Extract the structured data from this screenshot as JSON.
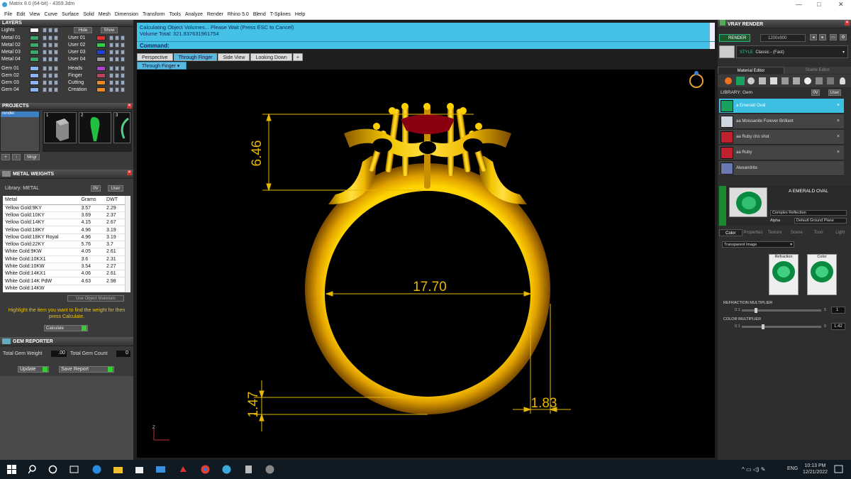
{
  "window": {
    "title": "Matrix 8.0 (64-bit) - 4359.3dm",
    "min": "—",
    "max": "□",
    "close": "✕"
  },
  "menu": [
    "File",
    "Edit",
    "View",
    "Curve",
    "Surface",
    "Solid",
    "Mesh",
    "Dimension",
    "Transform",
    "Tools",
    "Analyze",
    "Render",
    "Rhino 5.0",
    "Blend",
    "T-Splines",
    "Help"
  ],
  "layers": {
    "title": "LAYERS",
    "hide_label": "Hide",
    "show_label": "Show",
    "left": [
      {
        "name": "Lights",
        "color": "#ffffff"
      },
      {
        "name": "Metal 01",
        "color": "#3aa86a"
      },
      {
        "name": "Metal 02",
        "color": "#3aa86a"
      },
      {
        "name": "Metal 03",
        "color": "#3aa86a"
      },
      {
        "name": "Metal 04",
        "color": "#3aa86a"
      },
      {
        "name": "Gem 01",
        "color": "#8ab4f8"
      },
      {
        "name": "Gem 02",
        "color": "#8ab4f8"
      },
      {
        "name": "Gem 03",
        "color": "#8ab4f8"
      },
      {
        "name": "Gem 04",
        "color": "#8ab4f8"
      }
    ],
    "right": [
      {
        "name": "User 01",
        "color": "#e83030"
      },
      {
        "name": "User 02",
        "color": "#2ad24a"
      },
      {
        "name": "User 03",
        "color": "#2040e0"
      },
      {
        "name": "User 04",
        "color": "#9a9a9a"
      },
      {
        "name": "Heads",
        "color": "#b040d0"
      },
      {
        "name": "Finger",
        "color": "#c04060"
      },
      {
        "name": "Cutting",
        "color": "#f08a20"
      },
      {
        "name": "Creation",
        "color": "#f08a20"
      }
    ]
  },
  "projects": {
    "title": "PROJECTS",
    "item": "render",
    "thumbs": [
      "1",
      "2",
      "3"
    ],
    "mngr_label": "Mngr"
  },
  "metal_weights": {
    "title": "METAL WEIGHTS",
    "library_label": "Library: METAL",
    "lib_btn_0": "0V",
    "lib_btn_user": "User",
    "columns": [
      "Metal",
      "Grams",
      "DWT"
    ],
    "rows": [
      [
        "Yellow Gold:9KY",
        "3.57",
        "2.29"
      ],
      [
        "Yellow Gold:10KY",
        "3.69",
        "2.37"
      ],
      [
        "Yellow Gold:14KY",
        "4.15",
        "2.67"
      ],
      [
        "Yellow Gold:18KY",
        "4.96",
        "3.19"
      ],
      [
        "Yellow Gold:18KY Royal",
        "4.96",
        "3.19"
      ],
      [
        "Yellow Gold:22KY",
        "5.76",
        "3.7"
      ],
      [
        "White Gold:9KW",
        "4.05",
        "2.61"
      ],
      [
        "White Gold:10KX1",
        "3.6",
        "2.31"
      ],
      [
        "White Gold:10KW",
        "3.54",
        "2.27"
      ],
      [
        "White Gold:14KX1",
        "4.06",
        "2.61"
      ],
      [
        "White Gold:14K PdW",
        "4.63",
        "2.98"
      ],
      [
        "White Gold:14KW",
        "",
        ""
      ]
    ],
    "use_object_materials": "Use Object Materials",
    "hint": "Highlight the item you want to find the weight for then press Calculate.",
    "calculate": "Calculate"
  },
  "gem_reporter": {
    "title": "GEM REPORTER",
    "total_weight_label": "Total Gem Weight",
    "total_weight_value": ".00",
    "total_count_label": "Total Gem Count",
    "total_count_value": "0",
    "update": "Update",
    "save_report": "Save Report"
  },
  "messages": {
    "line1": "Calculating Object Volumes... Please Wait (Press ESC to Cancel)",
    "line2": "Volume Total: 321.837631961754",
    "command_label": "Command:"
  },
  "view_tabs": [
    "Perspective",
    "Through Finger",
    "Side View",
    "Looking Down",
    "+"
  ],
  "active_view": "Through Finger",
  "dimensions": {
    "top": "6.46",
    "width": "17.70",
    "bottom_left": "1.47",
    "bottom_right": "1.83"
  },
  "axis_label": "Z",
  "vray": {
    "title": "VRAY RENDER",
    "render_btn": "RENDER",
    "resolution": "1200x900",
    "style_label": "STYLE",
    "style_value": "Classic - (Fast)",
    "tabs": [
      "Material Editor",
      "Scene Editor"
    ],
    "library_label": "LIBRARY: Gem",
    "lib_btn_0": "0V",
    "lib_btn_user": "User",
    "materials": [
      {
        "name": "a Emerald Oval",
        "color": "#19a060"
      },
      {
        "name": "aa Moissanite Forever Brilliant",
        "color": "#cfd6e0"
      },
      {
        "name": "aa Ruby cho shot",
        "color": "#c02030"
      },
      {
        "name": "aa Ruby",
        "color": "#c02030"
      },
      {
        "name": "Alexandrite",
        "color": "#6a7ab0"
      }
    ],
    "selected_name": "A EMERALD OVAL",
    "reflection": "Complex Reflection",
    "alpha_label": "Alpha",
    "ground": "Default Ground Plane",
    "prop_tabs": [
      "Color",
      "Properties",
      "Texture",
      "Scene",
      "Toon",
      "Light"
    ],
    "transparent": "Transparent Image",
    "refraction_label": "Refraction",
    "color_label": "Color",
    "refr_mult_label": "REFRACTION MULTIPLIER",
    "refr_min": "0.1",
    "refr_max": "5",
    "refr_value": "1",
    "color_mult_label": "COLOR MULTIPLIER",
    "color_min": "0.1",
    "color_max": "5",
    "color_value": "1.42"
  },
  "taskbar": {
    "time": "10:13 PM",
    "date": "12/21/2022",
    "lang": "ENG"
  }
}
